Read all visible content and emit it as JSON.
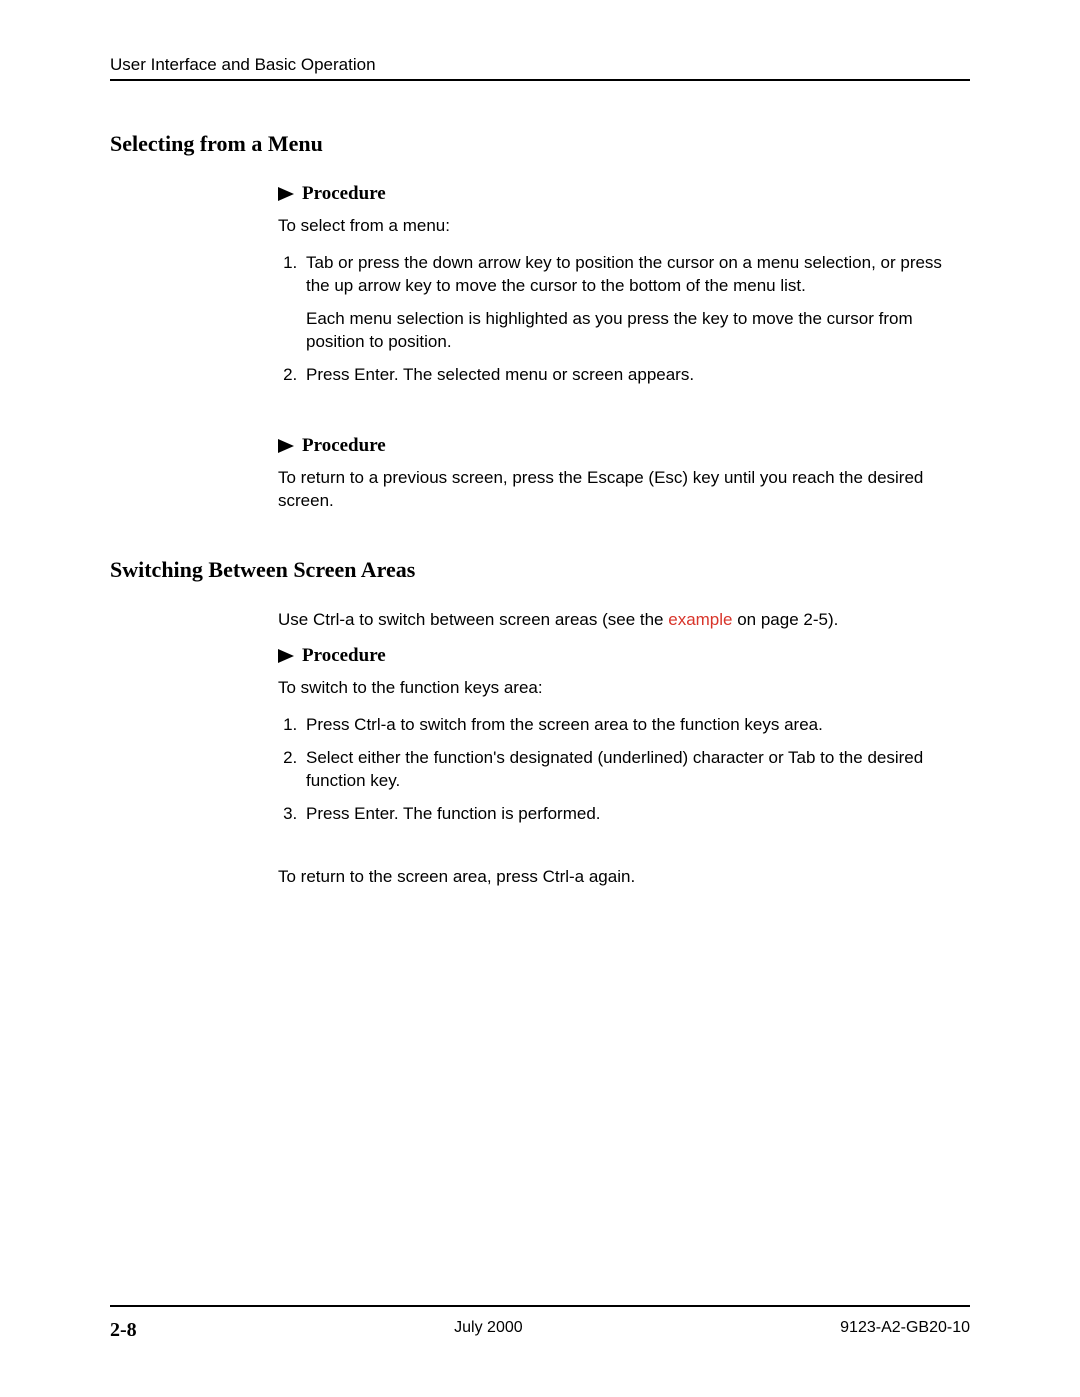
{
  "header": {
    "running_title": "User Interface and Basic Operation"
  },
  "sections": {
    "s1": {
      "title": "Selecting from a Menu",
      "proc1": {
        "label": "Procedure",
        "intro": "To select from a menu:",
        "step1a": "Tab or press the down arrow key to position the cursor on a menu selection, or press the up arrow key to move the cursor to the bottom of the menu list.",
        "step1b": "Each menu selection is highlighted as you press the key to move the cursor from position to position.",
        "step2": "Press Enter. The selected menu or screen appears."
      },
      "proc2": {
        "label": "Procedure",
        "text": "To return to a previous screen, press the Escape (Esc) key until you reach the desired screen."
      }
    },
    "s2": {
      "title": "Switching Between Screen Areas",
      "intro_pre": "Use Ctrl-a to switch between screen areas (see the ",
      "intro_link": "example",
      "intro_post": " on page 2-5).",
      "proc1": {
        "label": "Procedure",
        "intro": "To switch to the function keys area:",
        "step1": "Press Ctrl-a to switch from the screen area to the function keys area.",
        "step2": "Select either the function's designated (underlined) character or Tab to the desired function key.",
        "step3": "Press Enter. The function is performed."
      },
      "outro": "To return to the screen area, press Ctrl-a again."
    }
  },
  "footer": {
    "page": "2-8",
    "date": "July 2000",
    "docnum": "9123-A2-GB20-10"
  }
}
